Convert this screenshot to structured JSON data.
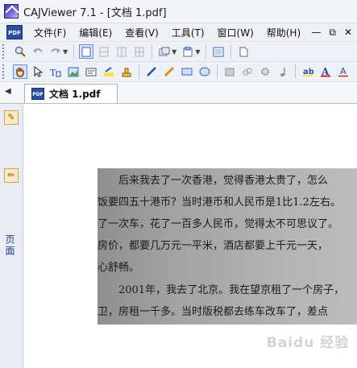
{
  "window": {
    "title": "CAJViewer 7.1 - [文档 1.pdf]"
  },
  "menu": {
    "items": [
      "文件(F)",
      "编辑(E)",
      "查看(V)",
      "工具(T)",
      "窗口(W)",
      "帮助(H)"
    ],
    "window_controls": [
      "—",
      "⧉",
      "✕"
    ]
  },
  "toolbar1": {
    "icons": [
      "search-icon",
      "undo-icon",
      "redo-icon",
      "select-page-icon",
      "split-h-icon",
      "split-v-icon",
      "grid-icon",
      "layout-icon",
      "export-icon",
      "window-icon",
      "document-icon"
    ]
  },
  "toolbar2": {
    "icons": [
      "hand-icon",
      "pointer-icon",
      "text-select-icon",
      "image-select-icon",
      "ocr-icon",
      "highlight-icon",
      "stamp-icon",
      "pen-icon",
      "marker-icon",
      "rectangle-icon",
      "ellipse-icon",
      "eraser-icon",
      "link-icon",
      "gear-icon",
      "music-icon",
      "text-color-icon",
      "font-icon",
      "underline-icon"
    ]
  },
  "tabs": {
    "document_tab": "文档 1.pdf",
    "pdf_badge": "PDF"
  },
  "side_panel": {
    "label": "页面"
  },
  "document": {
    "lines": [
      "　　后来我去了一次香港，觉得香港太贵了，怎么",
      "饭要四五十港币？当时港币和人民币是1比1.2左右。",
      "了一次车，花了一百多人民币，觉得太不可思议了。",
      "房价，都要几万元一平米，酒店都要上千元一天，",
      "心舒畅。",
      "　　2001年，我去了北京。我在望京租了一个房子，",
      "卫，房租一千多。当时版税都去练车改车了，差点"
    ]
  },
  "watermark": {
    "text": "Baidu 经验"
  }
}
